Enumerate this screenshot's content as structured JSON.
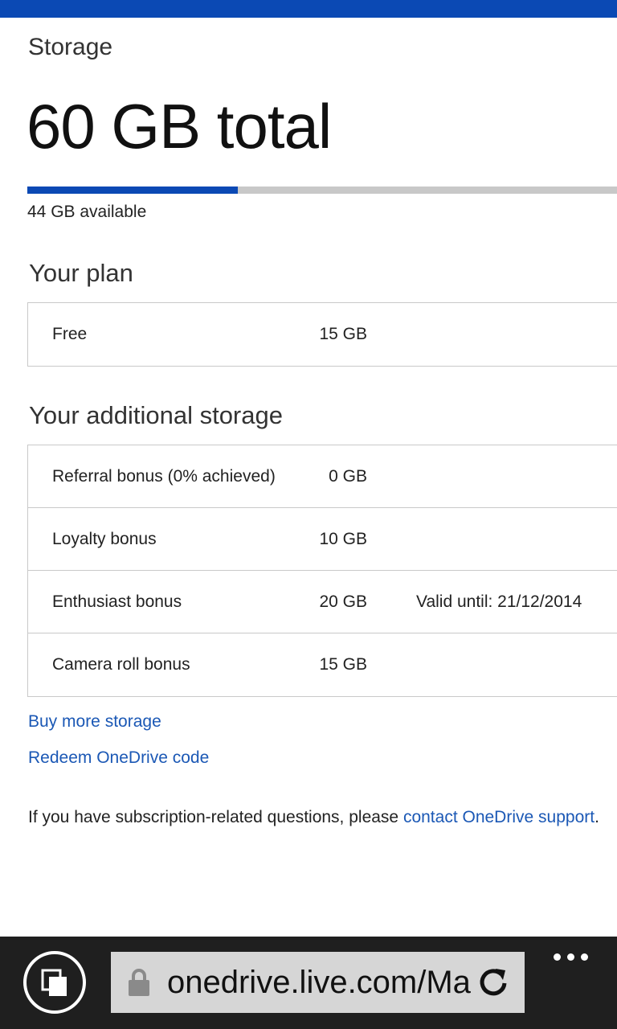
{
  "header": {
    "page_label": "Storage",
    "total": "60 GB total",
    "used_fraction": 0.3567,
    "available": "44 GB available"
  },
  "plan": {
    "title": "Your plan",
    "rows": [
      {
        "name": "Free",
        "size": "15 GB",
        "note": ""
      }
    ]
  },
  "additional": {
    "title": "Your additional storage",
    "rows": [
      {
        "name": "Referral bonus (0% achieved)",
        "size": "0 GB",
        "note": ""
      },
      {
        "name": "Loyalty bonus",
        "size": "10 GB",
        "note": ""
      },
      {
        "name": "Enthusiast bonus",
        "size": "20 GB",
        "note": "Valid until: 21/12/2014"
      },
      {
        "name": "Camera roll bonus",
        "size": "15 GB",
        "note": ""
      }
    ]
  },
  "links": {
    "buy_more": "Buy more storage",
    "redeem": "Redeem OneDrive code"
  },
  "footer": {
    "text": "If you have subscription-related questions, please ",
    "link": "contact OneDrive support",
    "end": "."
  },
  "browser": {
    "url": "onedrive.live.com/Ma",
    "icons": [
      "tabs-icon",
      "lock-icon",
      "refresh-icon",
      "more-icon"
    ]
  },
  "colors": {
    "accent": "#0b49b4",
    "link": "#1b58b5",
    "bar_background": "#1f1f1f"
  }
}
